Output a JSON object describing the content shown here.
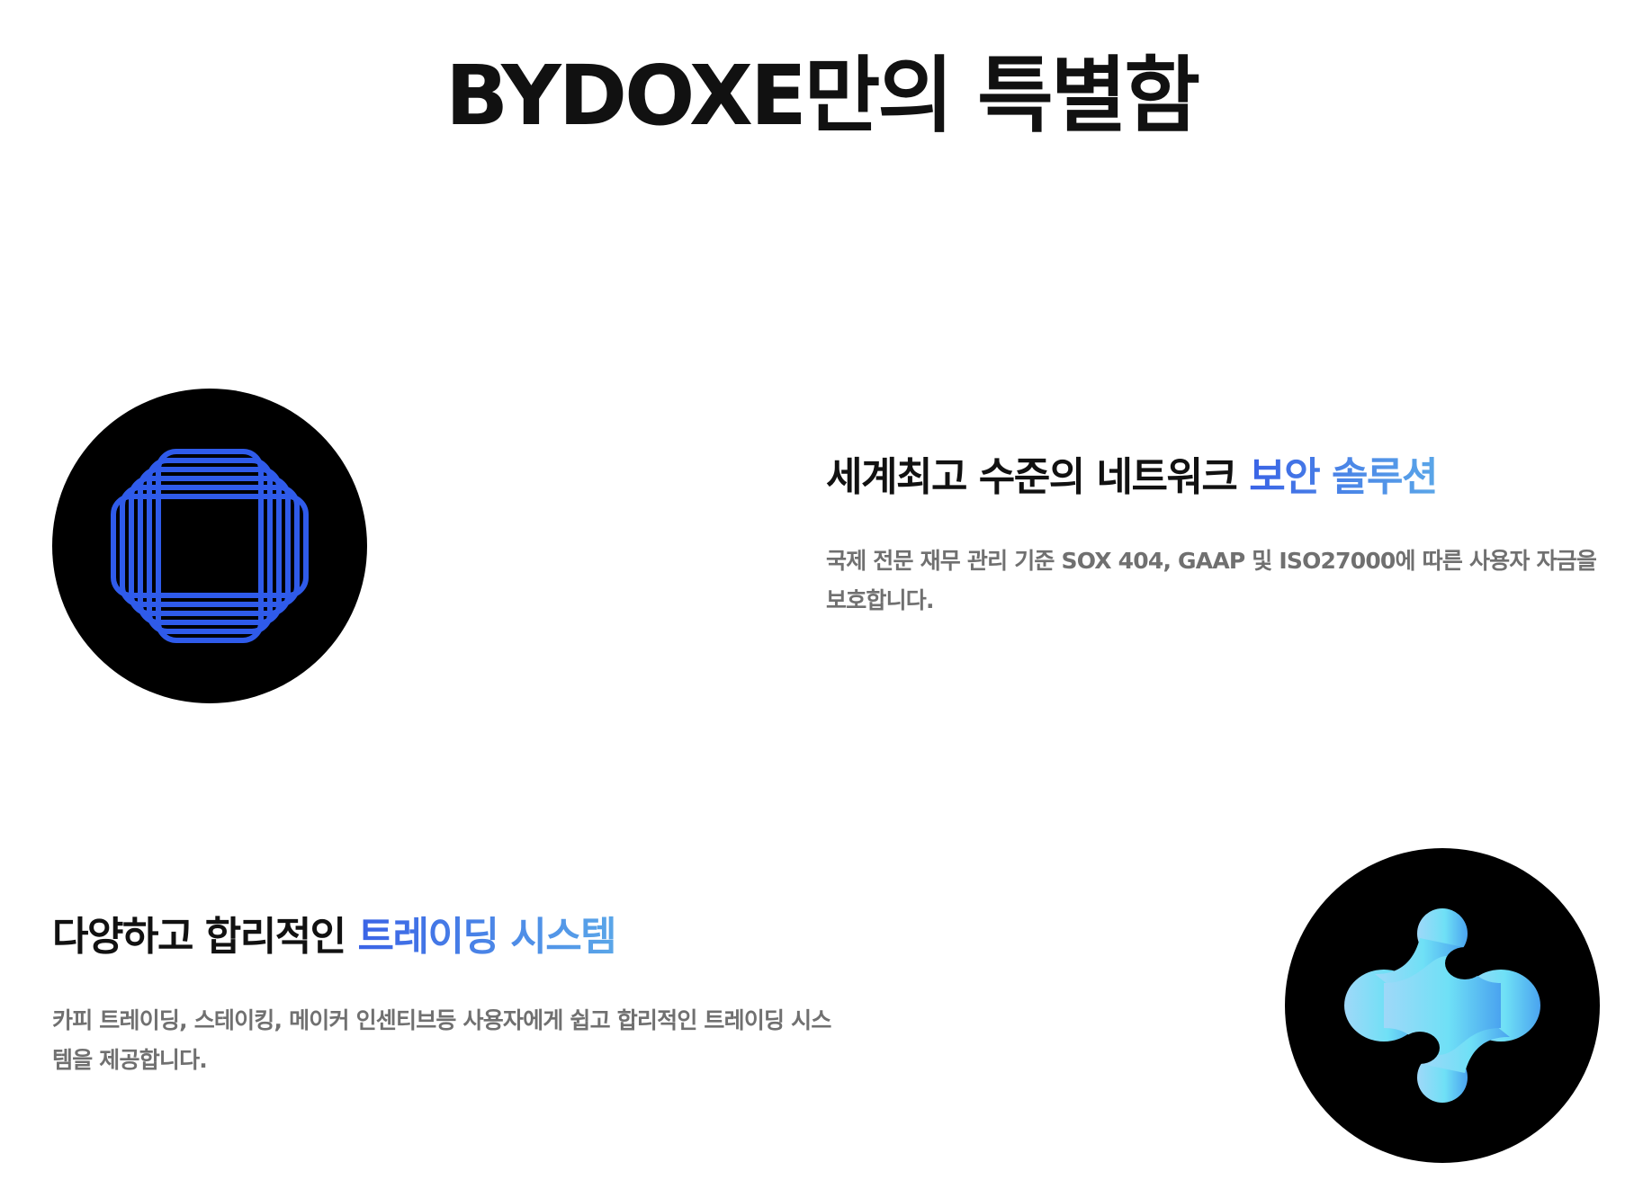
{
  "header": {
    "title": "BYDOXE만의 특별함"
  },
  "features": [
    {
      "icon": "security-grid-icon",
      "heading_prefix": "세계최고 수준의 네트워크 ",
      "heading_accent": "보안 솔루션",
      "description": "국제 전문 재무 관리 기준 SOX 404, GAAP 및 ISO27000에 따른 사용자 자금을 보호합니다."
    },
    {
      "icon": "trading-link-icon",
      "heading_prefix": "다양하고 합리적인 ",
      "heading_accent": "트레이딩 시스템",
      "description": "카피 트레이딩, 스테이킹, 메이커 인센티브등 사용자에게 쉽고 합리적인 트레이딩 시스템을 제공합니다."
    }
  ],
  "colors": {
    "accent_start": "#3a63e6",
    "accent_end": "#5aa6e8",
    "security_icon_blue": "#2f5bea",
    "trading_icon_light": "#9fd8f8",
    "trading_icon_cyan": "#6fe0f6",
    "trading_icon_blue": "#4aa3ef",
    "icon_background": "#000000"
  }
}
